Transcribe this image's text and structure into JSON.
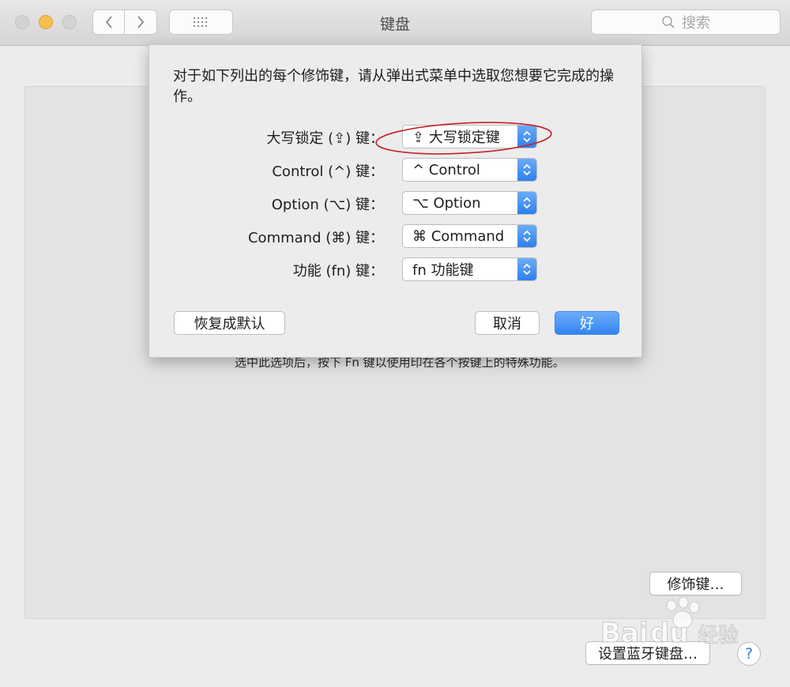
{
  "window": {
    "title": "键盘",
    "search_placeholder": "搜索"
  },
  "icons": {
    "nav_back": "chevron-left-icon",
    "nav_forward": "chevron-right-icon",
    "show_all": "grid-icon",
    "search": "magnifier-icon",
    "popup_arrows": "up-down-chevron-icon"
  },
  "colors": {
    "accent": "#3385f2",
    "minimize": "#f6bf4f",
    "annotation": "#c8202b"
  },
  "sheet": {
    "description": "对于如下列出的每个修饰键，请从弹出式菜单中选取您想要它完成的操作。",
    "rows": [
      {
        "label": "大写锁定 (⇪) 键：",
        "value": "⇪ 大写锁定键"
      },
      {
        "label": "Control (^) 键：",
        "value": "^ Control"
      },
      {
        "label": "Option (⌥) 键：",
        "value": "⌥ Option"
      },
      {
        "label": "Command (⌘) 键：",
        "value": "⌘ Command"
      },
      {
        "label": "功能 (fn) 键：",
        "value": "fn 功能键"
      }
    ],
    "restore_label": "恢复成默认",
    "cancel_label": "取消",
    "ok_label": "好"
  },
  "background": {
    "hint": "选中此选项后，按下 Fn 键以使用印在各个按键上的特殊功能。",
    "modifier_keys_label": "修饰键…",
    "bluetooth_label": "设置蓝牙键盘…",
    "help_label": "?"
  },
  "watermark": {
    "brand": "Bai",
    "brand_suffix": "du",
    "product": "经验"
  }
}
